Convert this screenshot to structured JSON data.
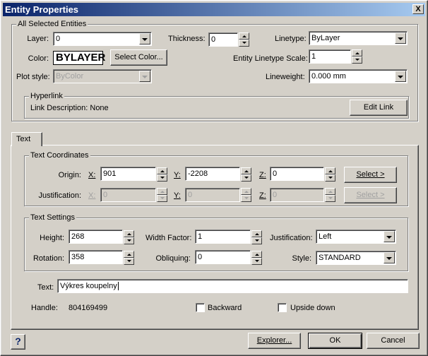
{
  "window": {
    "title": "Entity Properties",
    "close_label": "X"
  },
  "all_selected": {
    "group_label": "All Selected Entities",
    "layer_label": "Layer:",
    "layer_value": "0",
    "thickness_label": "Thickness:",
    "thickness_value": "0",
    "linetype_label": "Linetype:",
    "linetype_value": "ByLayer",
    "color_label": "Color:",
    "color_value": "BYLAYER",
    "select_color_label": "Select Color...",
    "linetype_scale_label": "Entity Linetype Scale:",
    "linetype_scale_value": "1",
    "plot_style_label": "Plot style:",
    "plot_style_value": "ByColor",
    "lineweight_label": "Lineweight:",
    "lineweight_value": "0.000 mm"
  },
  "hyperlink": {
    "group_label": "Hyperlink",
    "description": "Link Description: None",
    "edit_link_label": "Edit Link"
  },
  "tabs": [
    {
      "label": "Text",
      "active": true
    }
  ],
  "text_coordinates": {
    "group_label": "Text Coordinates",
    "origin_label": "Origin:",
    "justification_label": "Justification:",
    "x_label": "X:",
    "y_label": "Y:",
    "z_label": "Z:",
    "origin": {
      "x": "901",
      "y": "-2208",
      "z": "0"
    },
    "justification": {
      "x": "0",
      "y": "0",
      "z": "0"
    },
    "select_label": "Select >"
  },
  "text_settings": {
    "group_label": "Text Settings",
    "height_label": "Height:",
    "height_value": "268",
    "width_factor_label": "Width Factor:",
    "width_factor_value": "1",
    "justification_label": "Justification:",
    "justification_value": "Left",
    "rotation_label": "Rotation:",
    "rotation_value": "358",
    "obliquing_label": "Obliquing:",
    "obliquing_value": "0",
    "style_label": "Style:",
    "style_value": "STANDARD"
  },
  "text_field": {
    "label": "Text:",
    "value": "Výkres koupelny"
  },
  "handle": {
    "label": "Handle:",
    "value": "804169499"
  },
  "checkboxes": {
    "backward": {
      "label": "Backward",
      "checked": false
    },
    "upside_down": {
      "label": "Upside down",
      "checked": false
    }
  },
  "footer": {
    "help_label": "?",
    "explorer_label": "Explorer...",
    "ok_label": "OK",
    "cancel_label": "Cancel"
  }
}
